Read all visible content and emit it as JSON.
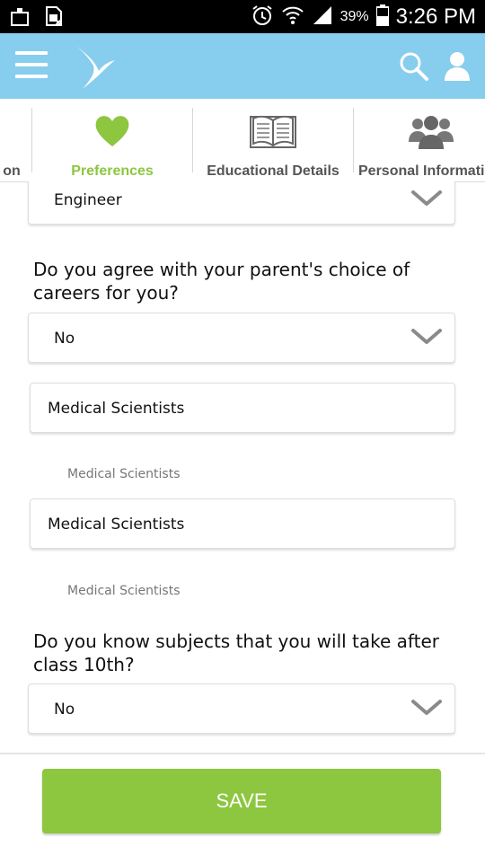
{
  "status_bar": {
    "battery": "39%",
    "time": "3:26 PM",
    "icons": [
      "notification-icon",
      "sim-icon",
      "alarm-icon",
      "wifi-icon",
      "signal-icon",
      "battery-icon"
    ]
  },
  "app_bar": {
    "color": "#87cdee",
    "icons": [
      "menu-icon",
      "bird-logo-icon",
      "search-icon",
      "user-icon"
    ]
  },
  "tabs": [
    {
      "label": "on",
      "icon": "none"
    },
    {
      "label": "Preferences",
      "icon": "heart-icon",
      "active": true
    },
    {
      "label": "Educational Details",
      "icon": "book-icon"
    },
    {
      "label": "Personal Information",
      "icon": "group-icon"
    }
  ],
  "form": {
    "career_select": {
      "value": "Engineer"
    },
    "q_parents_choice": {
      "text": "Do you agree with your parent's choice of careers for you?"
    },
    "parents_choice_select": {
      "value": "No"
    },
    "career_input_1": {
      "value": "Medical Scientists",
      "hint": "Medical Scientists"
    },
    "career_input_2": {
      "value": "Medical Scientists",
      "hint": "Medical Scientists"
    },
    "q_subjects": {
      "text": "Do you know subjects that you will take after class 10th?"
    },
    "subjects_select": {
      "value": "No"
    }
  },
  "footer": {
    "save_label": "SAVE",
    "save_color": "#8dc63f"
  },
  "colors": {
    "active_tab": "#8dc63f",
    "inactive_tab": "#555555"
  }
}
